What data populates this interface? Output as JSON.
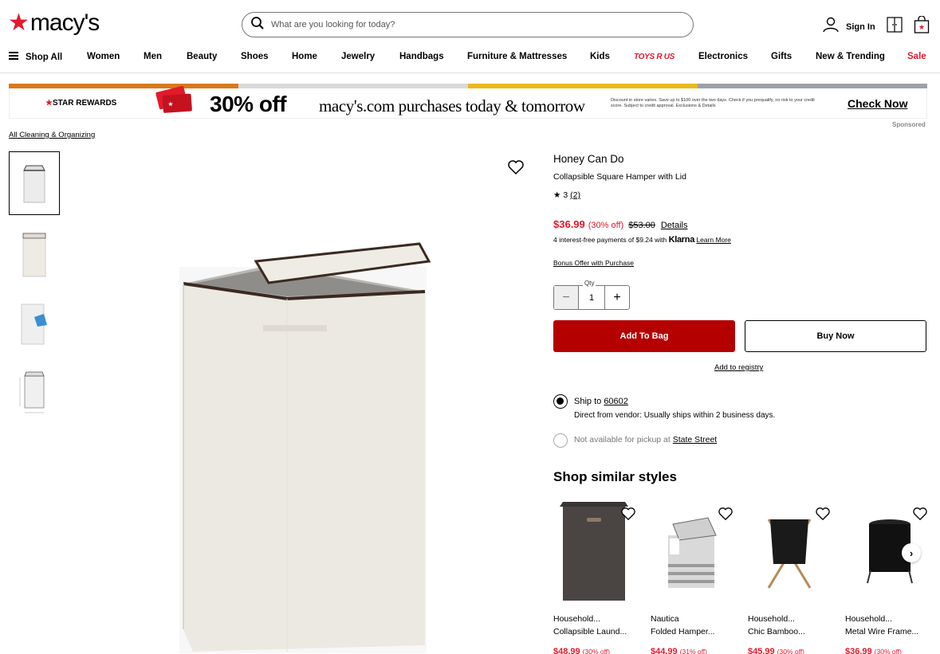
{
  "header": {
    "logo_text": "macy's",
    "search_placeholder": "What are you looking for today?",
    "signin_label": "Sign In"
  },
  "nav": {
    "shop_all": "Shop All",
    "items": [
      "Women",
      "Men",
      "Beauty",
      "Shoes",
      "Home",
      "Jewelry",
      "Handbags",
      "Furniture & Mattresses",
      "Kids",
      "TOYS R US",
      "Electronics",
      "Gifts",
      "New & Trending",
      "Sale"
    ]
  },
  "banner": {
    "strip_colors": [
      "#d97a1c",
      "#d9d9d9",
      "#eab81e",
      "#9ea1a3"
    ],
    "star_rewards": "STAR REWARDS",
    "headline": "30% off",
    "subline": "macy's.com purchases today & tomorrow",
    "fine_print": "Discount in store varies. Save up to $100 over the two days. Check if you prequalify, no risk to your credit score. Subject to credit approval. Exclusions & Details",
    "cta": "Check Now",
    "sponsored": "Sponsored"
  },
  "breadcrumb": "All Cleaning & Organizing",
  "product": {
    "brand": "Honey Can Do",
    "name": "Collapsible Square Hamper with Lid",
    "rating": "3",
    "review_count": "(2)",
    "price_now": "$36.99",
    "discount": "(30% off)",
    "price_was": "$53.00",
    "details_label": "Details",
    "klarna_text": "4 interest-free payments of $9.24 with",
    "klarna_brand": "Klarna",
    "learn_more": "Learn More",
    "bonus_offer": "Bonus Offer with Purchase",
    "qty_label": "Qty",
    "qty_value": "1",
    "add_to_bag": "Add To Bag",
    "buy_now": "Buy Now",
    "add_to_registry": "Add to registry",
    "ship_to_label": "Ship to",
    "zip": "60602",
    "ship_detail": "Direct from vendor: Usually ships within 2 business days.",
    "pickup_text": "Not available for pickup at",
    "pickup_store": "State Street"
  },
  "similar": {
    "title": "Shop similar styles",
    "items": [
      {
        "brand": "Household...",
        "name": "Collapsible Laund...",
        "price": "$48.99",
        "pct": "(30% off)"
      },
      {
        "brand": "Nautica",
        "name": "Folded Hamper...",
        "price": "$44.99",
        "pct": "(31% off)"
      },
      {
        "brand": "Household...",
        "name": "Chic Bamboo...",
        "price": "$45.99",
        "pct": "(30% off)"
      },
      {
        "brand": "Household...",
        "name": "Metal Wire Frame...",
        "price": "$36.99",
        "pct": "(30% off)"
      }
    ]
  },
  "colors": {
    "brand_red": "#e21a2c",
    "add_to_bag_bg": "#b50000"
  }
}
